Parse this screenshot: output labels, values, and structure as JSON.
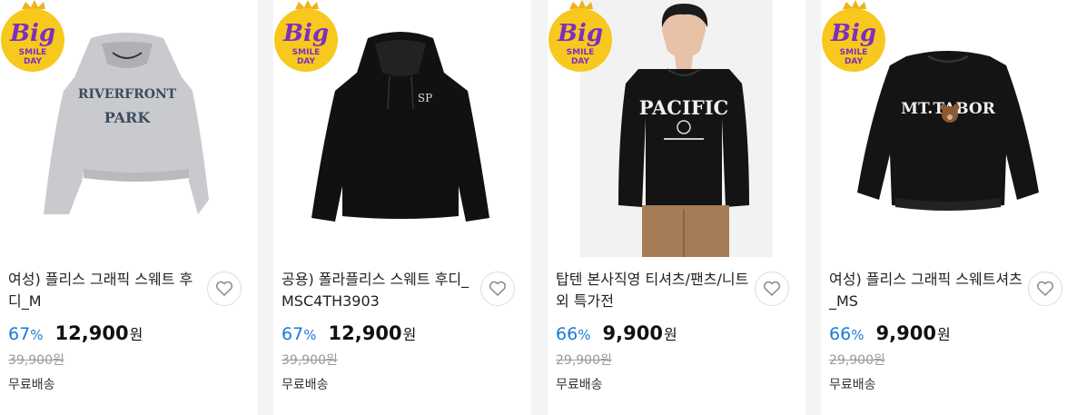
{
  "badge": {
    "big": "Big",
    "line1": "SMILE",
    "line2": "DAY"
  },
  "colors": {
    "discount": "#1a7ad9",
    "badge_bg": "#f7c81e",
    "badge_text": "#7d2fc0"
  },
  "products": [
    {
      "title": "여성) 플리스 그래픽 스웨트 후디_M",
      "rate": "67",
      "pct": "%",
      "price": "12,900",
      "won": "원",
      "original": "39,900원",
      "shipping": "무료배송",
      "print": "RIVERFRONT PARK",
      "wish_icon": "heart-outline-icon"
    },
    {
      "title": "공용) 폴라플리스 스웨트 후디_MSC4TH3903",
      "rate": "67",
      "pct": "%",
      "price": "12,900",
      "won": "원",
      "original": "39,900원",
      "shipping": "무료배송",
      "print": "SP",
      "wish_icon": "heart-outline-icon"
    },
    {
      "title": "탑텐 본사직영 티셔츠/팬츠/니트 외 특가전",
      "rate": "66",
      "pct": "%",
      "price": "9,900",
      "won": "원",
      "original": "29,900원",
      "shipping": "무료배송",
      "print": "PACIFIC",
      "wish_icon": "heart-outline-icon"
    },
    {
      "title": "여성) 플리스 그래픽 스웨트셔츠_MS",
      "rate": "66",
      "pct": "%",
      "price": "9,900",
      "won": "원",
      "original": "29,900원",
      "shipping": "무료배송",
      "print": "MT.TABOR",
      "wish_icon": "heart-outline-icon"
    }
  ]
}
